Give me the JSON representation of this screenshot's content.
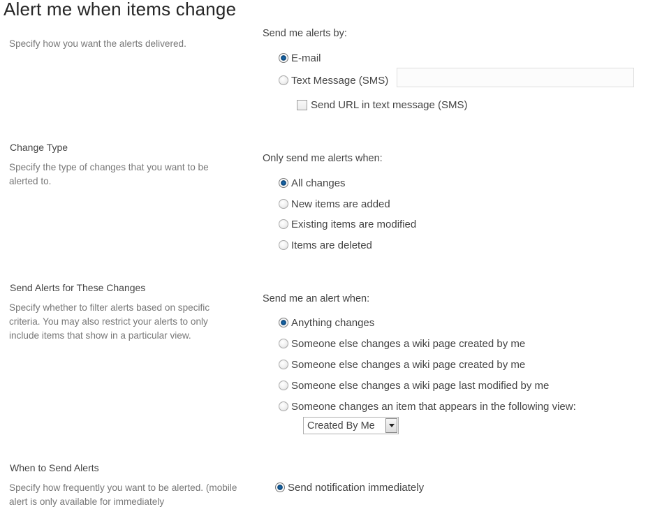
{
  "page": {
    "title": "Alert me when items change"
  },
  "delivery": {
    "description": "Specify how you want the alerts delivered.",
    "group_label": "Send me alerts by:",
    "options": [
      {
        "label": "E-mail",
        "checked": true
      },
      {
        "label": "Text Message (SMS)",
        "checked": false
      }
    ],
    "sms_number": {
      "value": "",
      "placeholder": ""
    },
    "send_url_checkbox": {
      "label": "Send URL in text message (SMS)",
      "checked": false
    }
  },
  "change_type": {
    "title": "Change Type",
    "description": "Specify the type of changes that you want to be alerted to.",
    "group_label": "Only send me alerts when:",
    "options": [
      {
        "label": "All changes",
        "checked": true
      },
      {
        "label": "New items are added",
        "checked": false
      },
      {
        "label": "Existing items are modified",
        "checked": false
      },
      {
        "label": "Items are deleted",
        "checked": false
      }
    ]
  },
  "filter": {
    "title": "Send Alerts for These Changes",
    "description": "Specify whether to filter alerts based on specific criteria. You may also restrict your alerts to only include items that show in a particular view.",
    "group_label": "Send me an alert when:",
    "options": [
      {
        "label": "Anything changes",
        "checked": true
      },
      {
        "label": "Someone else changes a wiki page created by me",
        "checked": false
      },
      {
        "label": "Someone else changes a wiki page created by me",
        "checked": false
      },
      {
        "label": "Someone else changes a wiki page last modified by me",
        "checked": false
      },
      {
        "label": "Someone changes an item that appears in the following view:",
        "checked": false
      }
    ],
    "view_select": {
      "selected": "Created By Me"
    }
  },
  "timing": {
    "title": "When to Send Alerts",
    "description": "Specify how frequently you want to be alerted. (mobile alert is only available for immediately",
    "options": [
      {
        "label": "Send notification immediately",
        "checked": true
      }
    ]
  }
}
